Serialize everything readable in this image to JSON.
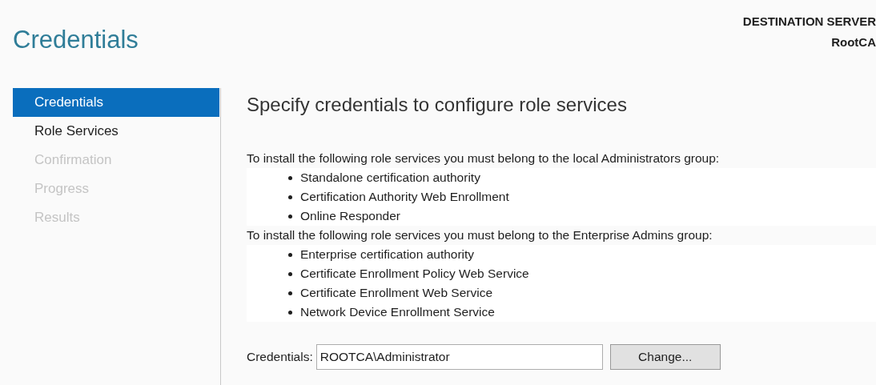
{
  "page_title": "Credentials",
  "destination": {
    "label": "DESTINATION SERVER",
    "server": "RootCA"
  },
  "sidebar": {
    "items": [
      {
        "label": "Credentials",
        "selected": true,
        "disabled": false
      },
      {
        "label": "Role Services",
        "selected": false,
        "disabled": false
      },
      {
        "label": "Confirmation",
        "selected": false,
        "disabled": true
      },
      {
        "label": "Progress",
        "selected": false,
        "disabled": true
      },
      {
        "label": "Results",
        "selected": false,
        "disabled": true
      }
    ]
  },
  "heading": "Specify credentials to configure role services",
  "groups": [
    {
      "intro": "To install the following role services you must belong to the local Administrators group:",
      "services": [
        "Standalone certification authority",
        "Certification Authority Web Enrollment",
        "Online Responder"
      ]
    },
    {
      "intro": "To install the following role services you must belong to the Enterprise Admins group:",
      "services": [
        "Enterprise certification authority",
        "Certificate Enrollment Policy Web Service",
        "Certificate Enrollment Web Service",
        "Network Device Enrollment Service"
      ]
    }
  ],
  "credentials": {
    "label": "Credentials:",
    "value": "ROOTCA\\Administrator",
    "button": "Change..."
  }
}
